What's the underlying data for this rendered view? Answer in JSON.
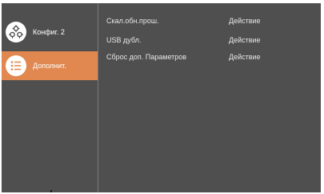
{
  "colors": {
    "panel_background": "#4f4f4f",
    "selected_item": "#e0884f",
    "text": "#ffffff"
  },
  "sidebar": {
    "items": [
      {
        "label": "Конфиг. 2",
        "icon": "gear-cluster-icon",
        "selected": false
      },
      {
        "label": "Дополнит.",
        "icon": "list-icon",
        "selected": true
      }
    ]
  },
  "settings": {
    "rows": [
      {
        "label": "Скал.обн.прош.",
        "value": "Действие"
      },
      {
        "label": "USB дубл.",
        "value": "Действие"
      },
      {
        "label": "Сброс доп. Параметров",
        "value": "Действие"
      }
    ]
  }
}
